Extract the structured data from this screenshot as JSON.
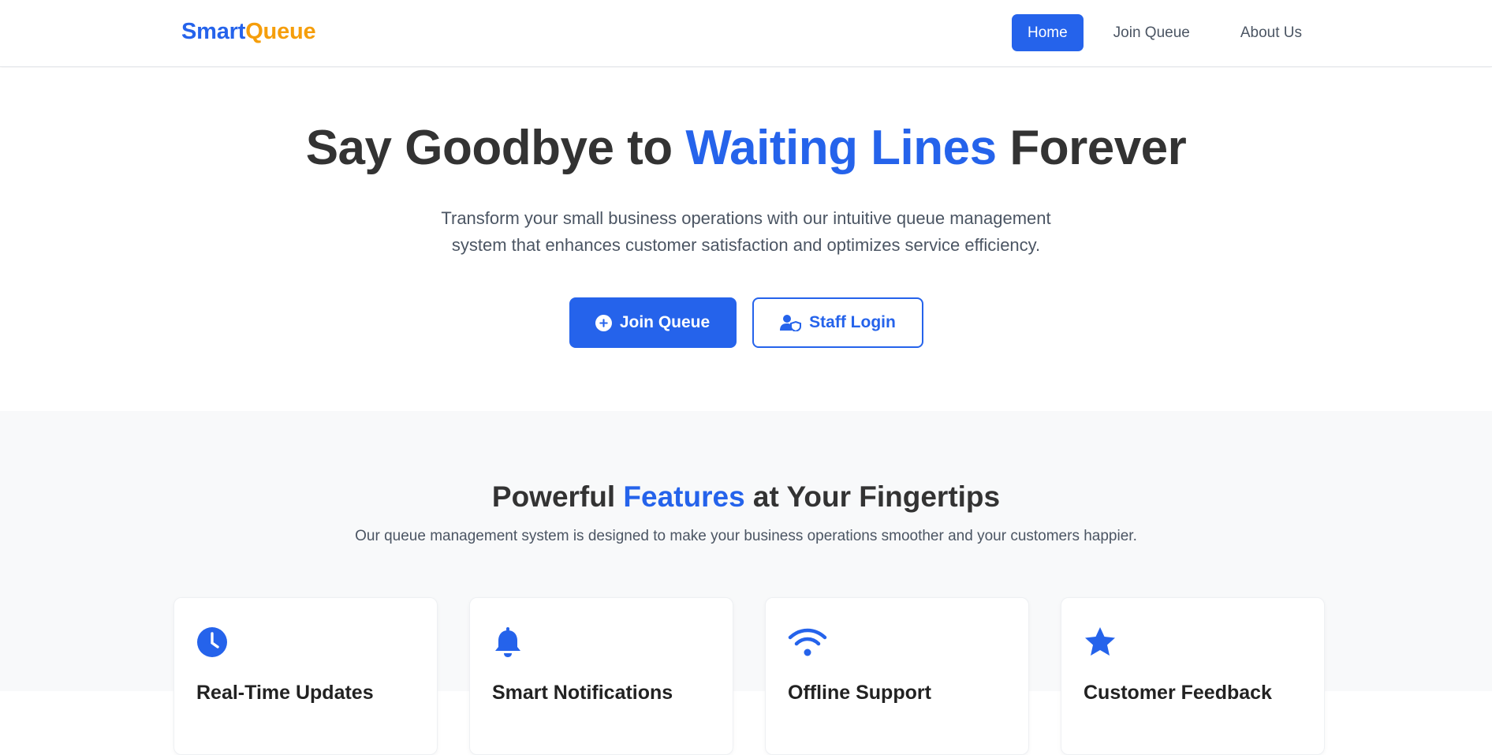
{
  "logo": {
    "part1": "Smart",
    "part2": "Queue"
  },
  "nav": {
    "items": [
      {
        "label": "Home",
        "active": true
      },
      {
        "label": "Join Queue",
        "active": false
      },
      {
        "label": "About Us",
        "active": false
      }
    ]
  },
  "hero": {
    "title_part1": "Say Goodbye to ",
    "title_highlight": "Waiting Lines",
    "title_part2": " Forever",
    "subtitle": "Transform your small business operations with our intuitive queue management system that enhances customer satisfaction and optimizes service efficiency.",
    "primary_button": {
      "label": "Join Queue",
      "icon": "plus-circle-icon"
    },
    "secondary_button": {
      "label": "Staff Login",
      "icon": "user-shield-icon"
    }
  },
  "features": {
    "title_part1": "Powerful ",
    "title_highlight": "Features",
    "title_part2": " at Your Fingertips",
    "subtitle": "Our queue management system is designed to make your business operations smoother and your customers happier.",
    "cards": [
      {
        "icon": "clock-icon",
        "title": "Real-Time Updates"
      },
      {
        "icon": "bell-icon",
        "title": "Smart Notifications"
      },
      {
        "icon": "wifi-icon",
        "title": "Offline Support"
      },
      {
        "icon": "star-icon",
        "title": "Customer Feedback"
      }
    ]
  },
  "colors": {
    "primary": "#2563eb",
    "accent": "#f59e0b",
    "text": "#333333",
    "muted": "#4b5563",
    "section_bg": "#f8f9fa"
  }
}
